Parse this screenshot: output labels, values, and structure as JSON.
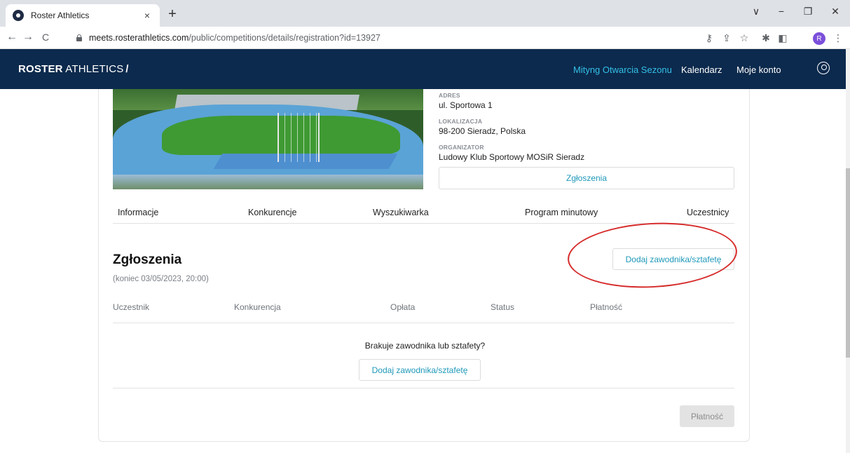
{
  "browser": {
    "tab_title": "Roster Athletics",
    "tab_close": "×",
    "new_tab": "+",
    "url_host": "meets.rosterathletics.com",
    "url_path": "/public/competitions/details/registration?id=13927",
    "profile_initial": "R",
    "window_controls": {
      "dropdown": "∨",
      "minimize": "−",
      "restore": "❐",
      "close": "✕"
    },
    "nav": {
      "back": "←",
      "forward": "→",
      "reload": "C"
    },
    "toolbar_icons": {
      "key": "⚷",
      "share": "⇪",
      "bookmark": "☆",
      "extensions": "✱",
      "sidebar": "◧",
      "menu": "⋮"
    }
  },
  "header": {
    "logo_bold": "ROSTER",
    "logo_thin": "ATHLETICS",
    "logo_mark": "\\",
    "nav": {
      "meet": "Mityng Otwarcia Sezonu",
      "calendar": "Kalendarz",
      "account": "Moje konto"
    },
    "colors": {
      "background": "#0c2a4d",
      "active_link": "#33c0e8"
    }
  },
  "competition": {
    "address_label": "ADRES",
    "address": "ul. Sportowa 1",
    "location_label": "LOKALIZACJA",
    "location": "98-200 Sieradz, Polska",
    "organizer_label": "ORGANIZATOR",
    "organizer": "Ludowy Klub Sportowy MOSiR Sieradz",
    "registrations_button": "Zgłoszenia"
  },
  "subnav": {
    "info": "Informacje",
    "events": "Konkurencje",
    "search": "Wyszukiwarka",
    "schedule": "Program minutowy",
    "participants": "Uczestnicy"
  },
  "registrations": {
    "title": "Zgłoszenia",
    "deadline": "(koniec 03/05/2023, 20:00)",
    "add_button": "Dodaj zawodnika/sztafetę",
    "columns": {
      "participant": "Uczestnik",
      "event": "Konkurencja",
      "fee": "Opłata",
      "status": "Status",
      "payment": "Płatność"
    },
    "empty_message": "Brakuje zawodnika lub sztafety?",
    "empty_add_button": "Dodaj zawodnika/sztafetę",
    "pay_button": "Płatność"
  },
  "annotation_color": "#d62b2b"
}
